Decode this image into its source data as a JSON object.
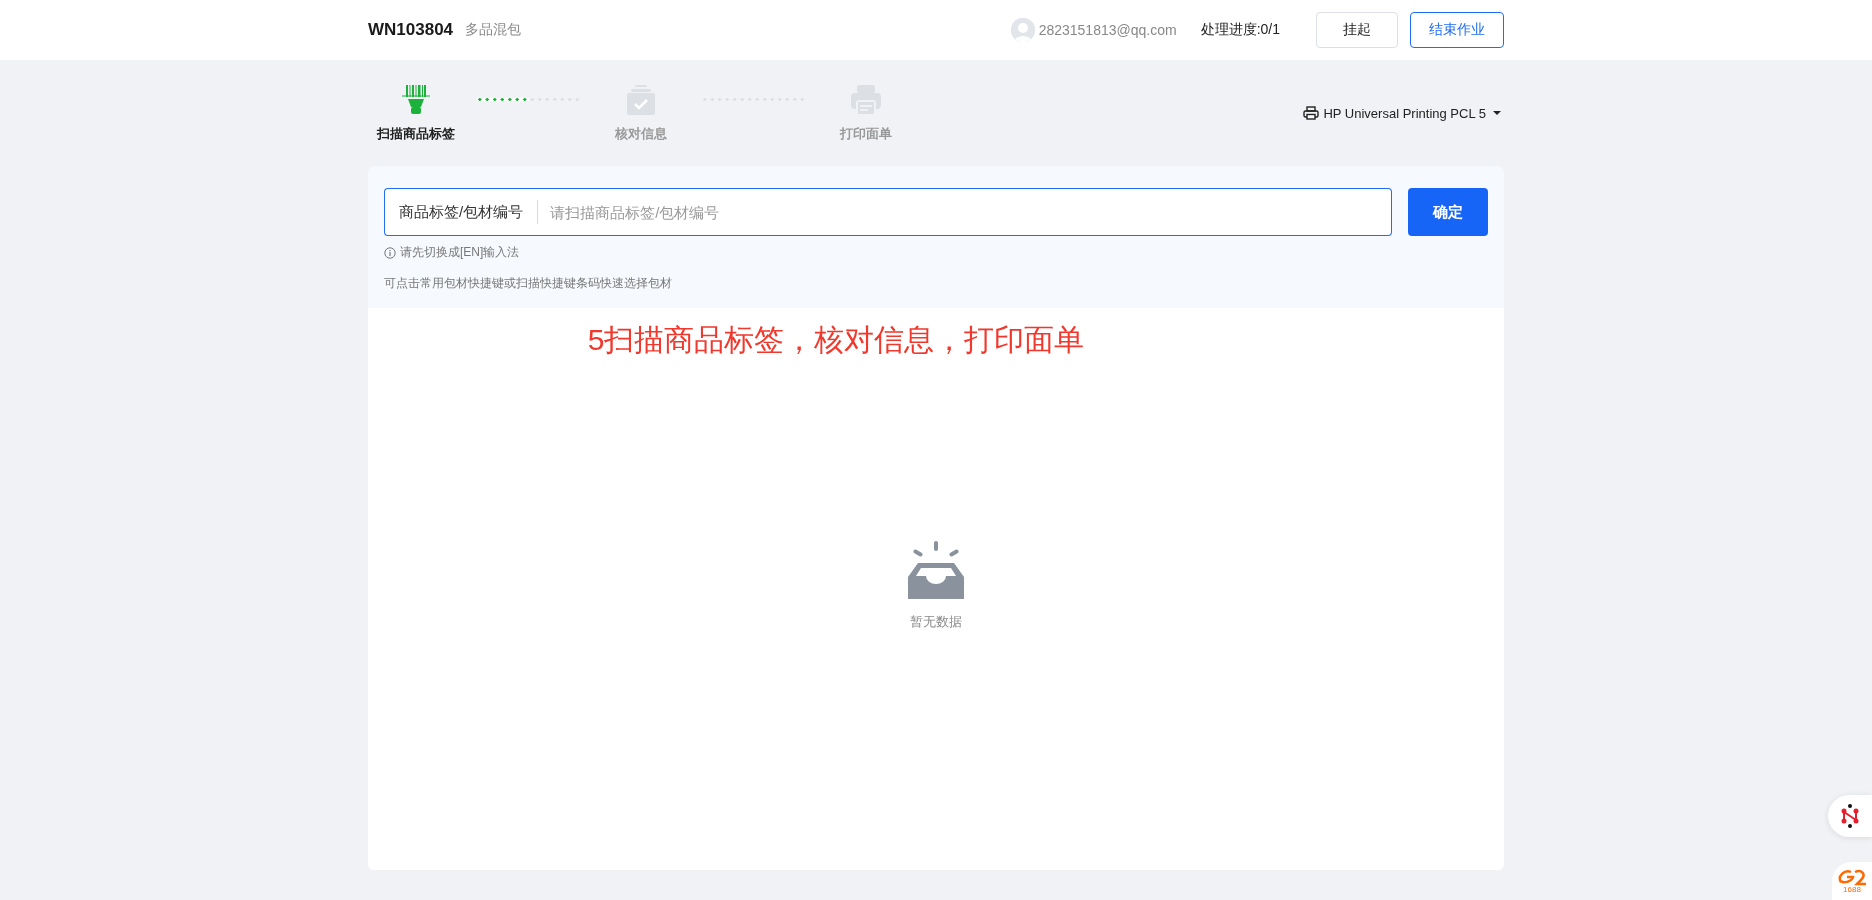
{
  "header": {
    "order_no": "WN103804",
    "order_type": "多品混包",
    "user_email": "2823151813@qq.com",
    "progress": "处理进度:0/1",
    "buttons": [
      {
        "label": "挂起",
        "kind": "default"
      },
      {
        "label": "结束作业",
        "kind": "outline"
      }
    ]
  },
  "steps": [
    {
      "label": "扫描商品标签",
      "kind": "scanner",
      "active": true
    },
    {
      "label": "核对信息",
      "kind": "check",
      "active": false
    },
    {
      "label": "打印面单",
      "kind": "printer",
      "active": false
    }
  ],
  "step_connectors": [
    {
      "level": 0.5
    }
  ],
  "printer": {
    "name": "HP Universal Printing PCL 5"
  },
  "scan": {
    "label": "商品标签/包材编号",
    "placeholder": "请扫描商品标签/包材编号",
    "button": "确定",
    "tip": "请先切换成[EN]输入法",
    "hint": "可点击常用包材快捷键或扫描快捷键条码快速选择包材"
  },
  "annotation": "5扫描商品标签，核对信息，打印面单",
  "empty": {
    "text": "暂无数据"
  },
  "floating": {
    "logo_text": "1688"
  }
}
